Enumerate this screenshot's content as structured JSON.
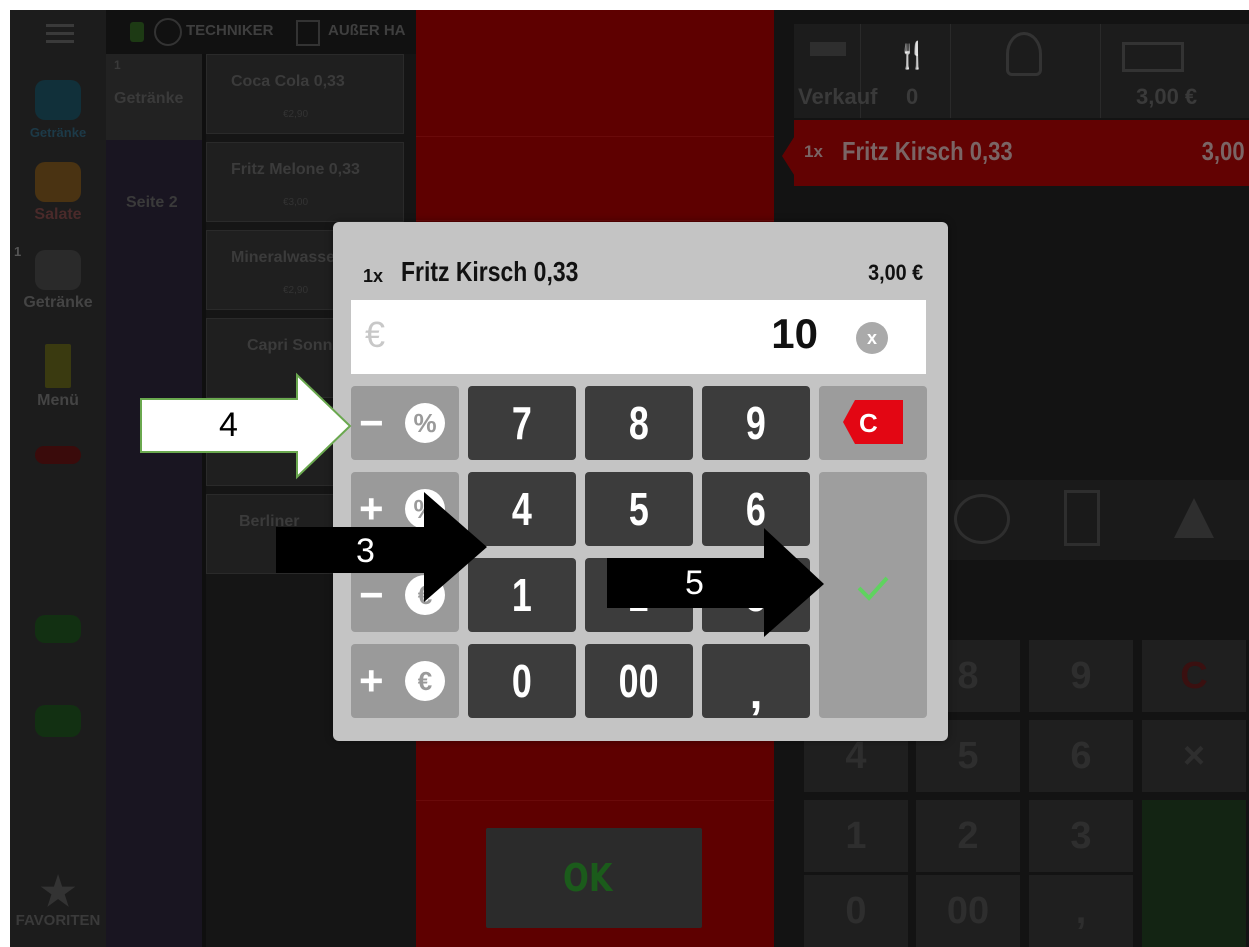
{
  "header": {
    "user": "TECHNIKER",
    "mode": "AUßER HA"
  },
  "sidebar": {
    "items": [
      {
        "label": "Getränke",
        "icon": "drink-icon"
      },
      {
        "label": "Salate",
        "icon": "salad-icon"
      },
      {
        "label": "Getränke",
        "icon": "drinks-icon",
        "badge": "1"
      },
      {
        "label": "Menü",
        "icon": "menu-card-icon"
      },
      {
        "label": "FAVORITEN",
        "icon": "star-icon"
      }
    ]
  },
  "categories": {
    "active": {
      "count": "1",
      "label": "Getränke"
    },
    "page": "Seite 2"
  },
  "products": [
    {
      "name": "Coca Cola 0,33",
      "price": "€2,90"
    },
    {
      "name": "Fritz Melone 0,33",
      "price": "€3,00"
    },
    {
      "name": "Mineralwasser",
      "price": "€2,90"
    },
    {
      "name": "Capri Sonne",
      "price": ""
    },
    {
      "name": "Berliner",
      "price": ""
    }
  ],
  "right_panel": {
    "top": {
      "label": "Verkauf",
      "count": "0",
      "total": "3,00 €"
    },
    "order_item": {
      "qty": "1x",
      "name": "Fritz Kirsch 0,33",
      "price": "3,00"
    },
    "keys": [
      "8",
      "9",
      "C",
      "4",
      "5",
      "6",
      "1",
      "2",
      "3",
      "0",
      "00",
      ","
    ]
  },
  "ok_button": "OK",
  "dialog": {
    "qty": "1x",
    "name": "Fritz Kirsch 0,33",
    "price": "3,00 €",
    "currency_placeholder": "€",
    "value": "10",
    "clear": "x",
    "keys": {
      "row1": [
        "7",
        "8",
        "9"
      ],
      "row2": [
        "4",
        "5",
        "6"
      ],
      "row3": [
        "1",
        "2",
        "3"
      ],
      "row4": [
        "0",
        "00",
        ","
      ],
      "clear": "C",
      "ops": [
        {
          "sign": "−",
          "unit": "%"
        },
        {
          "sign": "+",
          "unit": "%"
        },
        {
          "sign": "−",
          "unit": "€"
        },
        {
          "sign": "+",
          "unit": "€"
        }
      ]
    }
  },
  "annotations": {
    "a4": "4",
    "a3": "3",
    "a5": "5"
  },
  "colors": {
    "accent_red": "#e30613",
    "confirm_green": "#5fd35f",
    "annotation_border": "#6aa84f"
  }
}
